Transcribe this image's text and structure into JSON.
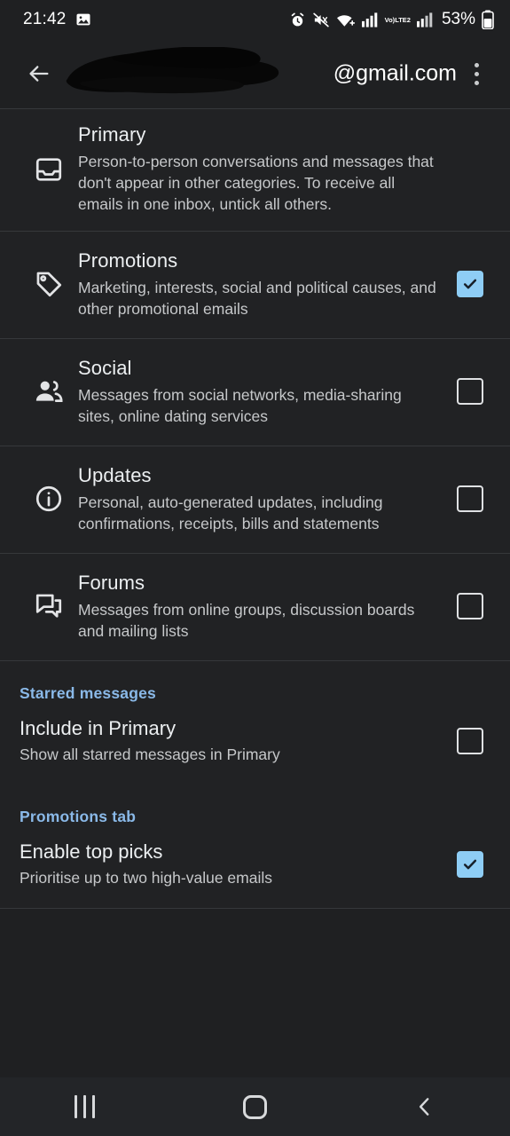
{
  "status_bar": {
    "time": "21:42",
    "battery_percent": "53%",
    "network_label_top": "Vo)",
    "network_label_bottom": "LTE2",
    "icons": [
      "image-icon",
      "alarm-icon",
      "mute-icon",
      "wifi-plus-icon",
      "signal-bars-icon",
      "volte-icon",
      "signal-bars-2-icon",
      "battery-icon"
    ]
  },
  "app_bar": {
    "title": "@gmail.com",
    "redacted": true,
    "back_icon": "back-arrow-icon",
    "menu_icon": "overflow-menu-icon"
  },
  "categories": [
    {
      "id": "primary",
      "icon": "inbox-icon",
      "title": "Primary",
      "description": "Person-to-person conversations and messages that don't appear in other categories. To receive all emails in one inbox, untick all others.",
      "has_checkbox": false,
      "checked": false
    },
    {
      "id": "promotions",
      "icon": "tag-icon",
      "title": "Promotions",
      "description": "Marketing, interests, social and political causes, and other promotional emails",
      "has_checkbox": true,
      "checked": true
    },
    {
      "id": "social",
      "icon": "people-icon",
      "title": "Social",
      "description": "Messages from social networks, media-sharing sites, online dating services",
      "has_checkbox": true,
      "checked": false
    },
    {
      "id": "updates",
      "icon": "info-circle-icon",
      "title": "Updates",
      "description": "Personal, auto-generated updates, including confirmations, receipts, bills and statements",
      "has_checkbox": true,
      "checked": false
    },
    {
      "id": "forums",
      "icon": "forum-icon",
      "title": "Forums",
      "description": "Messages from online groups, discussion boards and mailing lists",
      "has_checkbox": true,
      "checked": false
    }
  ],
  "sections": [
    {
      "id": "starred-messages",
      "header": "Starred messages",
      "option": {
        "title": "Include in Primary",
        "description": "Show all starred messages in Primary",
        "checked": false
      }
    },
    {
      "id": "promotions-tab",
      "header": "Promotions tab",
      "option": {
        "title": "Enable top picks",
        "description": "Prioritise up to two high-value emails",
        "checked": true
      }
    }
  ],
  "nav_bar": {
    "recents_icon": "recents-icon",
    "home_icon": "home-icon",
    "back_icon": "nav-back-icon"
  },
  "colors": {
    "background": "#1f2022",
    "surface": "#212224",
    "accent_blue": "#8ab9e8",
    "checkbox_checked": "#8ecdf5",
    "divider": "#36383b",
    "text_primary": "#eceff1",
    "text_secondary": "#c6c8ca"
  }
}
